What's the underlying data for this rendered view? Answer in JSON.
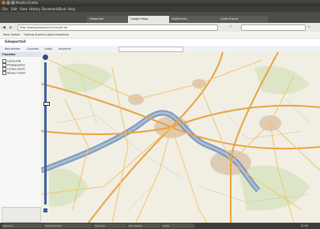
{
  "window": {
    "title": "Mozilla Firefox"
  },
  "menu": [
    "File",
    "Edit",
    "View",
    "History",
    "Bookmarks",
    "Tools",
    "Help"
  ],
  "tabs": [
    {
      "label": "Géoportail"
    },
    {
      "label": "Google Maps"
    },
    {
      "label": "ViaMichelin"
    },
    {
      "label": "Carte France"
    }
  ],
  "navbar": {
    "url": "http://www.geoportail.fr/visu2D.do"
  },
  "bookmarks": [
    "Most Visited",
    "Getting Started",
    "Latest Headlines"
  ],
  "page": {
    "logo": "Géoportail"
  },
  "app_toolbar": [
    "Rechercher",
    "Couches",
    "Outils",
    "Imprimer"
  ],
  "sidepanel": {
    "title": "Couches",
    "layers": [
      "Cartes IGN",
      "Photographies",
      "Limites admin.",
      "Réseau routier"
    ]
  },
  "statusbar": {
    "tasks": [
      "Terminé",
      "Mozilla Firefox",
      "Terminal",
      "Documents",
      "Carte"
    ],
    "clock": "12:00"
  },
  "colors": {
    "river": "#6f8bb0",
    "motorway": "#e8a33c",
    "road": "#f2c56b",
    "urban": "#d9c9b6",
    "forest": "#cfe0b4"
  }
}
